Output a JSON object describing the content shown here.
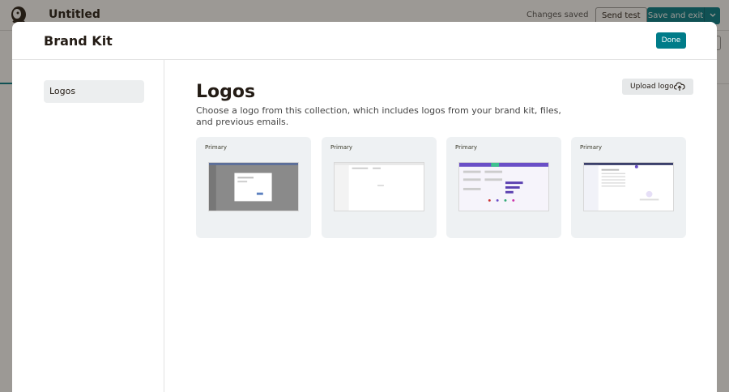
{
  "app": {
    "title": "Untitled",
    "status": "Changes saved",
    "send_test_label": "Send test",
    "save_exit_label": "Save and exit"
  },
  "modal": {
    "title": "Brand Kit",
    "done_label": "Done"
  },
  "sidebar": {
    "items": [
      {
        "label": "Logos"
      }
    ]
  },
  "content": {
    "title": "Logos",
    "description": "Choose a logo from this collection, which includes logos from your brand kit, files, and previous emails.",
    "upload_label": "Upload logo",
    "upload_icon": "cloud-upload-icon",
    "logos": [
      {
        "badge": "Primary"
      },
      {
        "badge": "Primary"
      },
      {
        "badge": "Primary"
      },
      {
        "badge": "Primary"
      }
    ]
  },
  "colors": {
    "accent": "#007c89",
    "overlay": "rgba(36,28,21,0.45)",
    "card_bg": "#eef1f3"
  }
}
